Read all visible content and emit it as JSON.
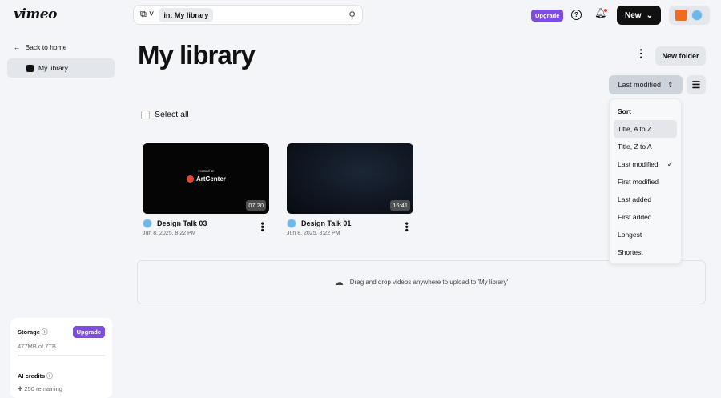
{
  "header": {
    "logo": "vimeo",
    "search_chip": "in: My library",
    "upgrade": "Upgrade",
    "new_button": "New"
  },
  "sidebar": {
    "back": "Back to home",
    "items": [
      {
        "label": "My library"
      }
    ],
    "storage": {
      "title": "Storage",
      "upgrade": "Upgrade",
      "used": "477MB of 7TB",
      "ai_title": "AI credits",
      "ai_remaining": "250 remaining"
    }
  },
  "main": {
    "title": "My library",
    "new_folder": "New folder",
    "sort_label": "Last modified",
    "select_all": "Select all",
    "drop_text": "Drag and drop videos anywhere to upload to 'My library'",
    "videos": [
      {
        "title": "Design Talk 03",
        "date": "Jun 8, 2025, 8:22 PM",
        "duration": "07:20",
        "thumb_small": "Hosted at",
        "thumb_brand": "ArtCenter"
      },
      {
        "title": "Design Talk 01",
        "date": "Jun 8, 2025, 8:22 PM",
        "duration": "16:41"
      }
    ]
  },
  "sort_menu": {
    "heading": "Sort",
    "options": [
      "Title, A to Z",
      "Title, Z to A",
      "Last modified",
      "First modified",
      "Last added",
      "First added",
      "Longest",
      "Shortest"
    ],
    "selected": "Last modified"
  },
  "colors": {
    "accent": "#7c4dde",
    "dark": "#111111"
  }
}
